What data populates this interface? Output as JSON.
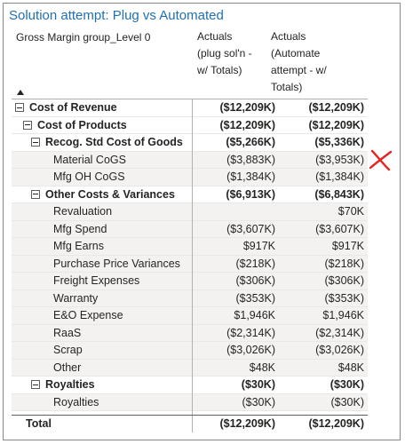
{
  "visual": {
    "title": "Solution attempt: Plug vs Automated",
    "title_color": "#1f6fb5"
  },
  "columns": {
    "label": "Gross Margin group_Level 0",
    "col1": [
      "Actuals",
      "(plug sol'n -",
      "w/ Totals)"
    ],
    "col2": [
      "Actuals",
      "(Automate",
      "attempt - w/",
      "Totals)"
    ]
  },
  "sort_icon": "triangle-up-icon",
  "rows": [
    {
      "label": "Cost of Revenue",
      "v1": "($12,209K)",
      "v2": "($12,209K)",
      "level": 0,
      "bold": true,
      "toggle": true
    },
    {
      "label": "Cost of Products",
      "v1": "($12,209K)",
      "v2": "($12,209K)",
      "level": 1,
      "bold": true,
      "toggle": true
    },
    {
      "label": "Recog. Std Cost of Goods",
      "v1": "($5,266K)",
      "v2": "($5,336K)",
      "level": 2,
      "bold": true,
      "toggle": true
    },
    {
      "label": "Material CoGS",
      "v1": "($3,883K)",
      "v2": "($3,953K)",
      "level": 3,
      "bold": false,
      "toggle": false
    },
    {
      "label": "Mfg OH CoGS",
      "v1": "($1,384K)",
      "v2": "($1,384K)",
      "level": 3,
      "bold": false,
      "toggle": false
    },
    {
      "label": "Other Costs & Variances",
      "v1": "($6,913K)",
      "v2": "($6,843K)",
      "level": 2,
      "bold": true,
      "toggle": true
    },
    {
      "label": "Revaluation",
      "v1": "",
      "v2": "$70K",
      "level": 3,
      "bold": false,
      "toggle": false
    },
    {
      "label": "Mfg Spend",
      "v1": "($3,607K)",
      "v2": "($3,607K)",
      "level": 3,
      "bold": false,
      "toggle": false
    },
    {
      "label": "Mfg Earns",
      "v1": "$917K",
      "v2": "$917K",
      "level": 3,
      "bold": false,
      "toggle": false
    },
    {
      "label": "Purchase Price Variances",
      "v1": "($218K)",
      "v2": "($218K)",
      "level": 3,
      "bold": false,
      "toggle": false
    },
    {
      "label": "Freight Expenses",
      "v1": "($306K)",
      "v2": "($306K)",
      "level": 3,
      "bold": false,
      "toggle": false
    },
    {
      "label": "Warranty",
      "v1": "($353K)",
      "v2": "($353K)",
      "level": 3,
      "bold": false,
      "toggle": false
    },
    {
      "label": "E&O Expense",
      "v1": "$1,946K",
      "v2": "$1,946K",
      "level": 3,
      "bold": false,
      "toggle": false
    },
    {
      "label": "RaaS",
      "v1": "($2,314K)",
      "v2": "($2,314K)",
      "level": 3,
      "bold": false,
      "toggle": false
    },
    {
      "label": "Scrap",
      "v1": "($3,026K)",
      "v2": "($3,026K)",
      "level": 3,
      "bold": false,
      "toggle": false
    },
    {
      "label": "Other",
      "v1": "$48K",
      "v2": "$48K",
      "level": 3,
      "bold": false,
      "toggle": false
    },
    {
      "label": "Royalties",
      "v1": "($30K)",
      "v2": "($30K)",
      "level": 2,
      "bold": true,
      "toggle": true
    },
    {
      "label": "Royalties",
      "v1": "($30K)",
      "v2": "($30K)",
      "level": 3,
      "bold": false,
      "toggle": false
    }
  ],
  "total": {
    "label": "Total",
    "v1": "($12,209K)",
    "v2": "($12,209K)"
  },
  "annotation": {
    "icon": "red-x-mark-icon",
    "color": "#e8231f"
  }
}
